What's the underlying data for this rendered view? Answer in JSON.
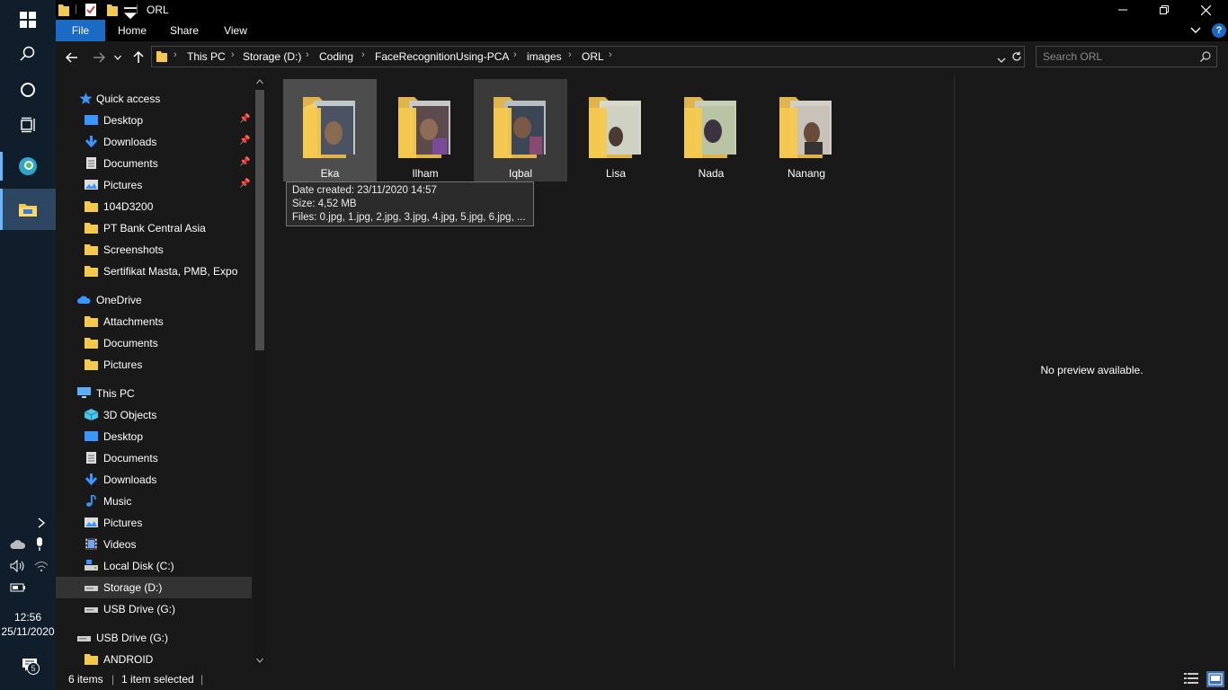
{
  "window": {
    "title": "ORL",
    "colors": {
      "file_tab": "#1b6ac4",
      "background": "#191919",
      "taskbar": "#101e2b"
    }
  },
  "ribbon": {
    "tabs": [
      "File",
      "Home",
      "Share",
      "View"
    ]
  },
  "address": {
    "crumbs": [
      "This PC",
      "Storage (D:)",
      "Coding",
      "FaceRecognitionUsing-PCA",
      "images",
      "ORL"
    ]
  },
  "search": {
    "placeholder": "Search ORL"
  },
  "nav": {
    "quick_access": {
      "label": "Quick access",
      "items": [
        {
          "label": "Desktop",
          "icon": "desktop-icon",
          "pinned": true
        },
        {
          "label": "Downloads",
          "icon": "downloads-icon",
          "pinned": true
        },
        {
          "label": "Documents",
          "icon": "documents-icon",
          "pinned": true
        },
        {
          "label": "Pictures",
          "icon": "pictures-icon",
          "pinned": true
        },
        {
          "label": "104D3200",
          "icon": "folder-icon"
        },
        {
          "label": "PT Bank Central Asia",
          "icon": "folder-icon"
        },
        {
          "label": "Screenshots",
          "icon": "folder-icon"
        },
        {
          "label": "Sertifikat Masta, PMB, Expo",
          "icon": "folder-icon"
        }
      ]
    },
    "onedrive": {
      "label": "OneDrive",
      "items": [
        {
          "label": "Attachments",
          "icon": "folder-icon"
        },
        {
          "label": "Documents",
          "icon": "folder-icon"
        },
        {
          "label": "Pictures",
          "icon": "folder-icon"
        }
      ]
    },
    "this_pc": {
      "label": "This PC",
      "items": [
        {
          "label": "3D Objects",
          "icon": "3d-objects-icon"
        },
        {
          "label": "Desktop",
          "icon": "desktop-icon"
        },
        {
          "label": "Documents",
          "icon": "documents-icon"
        },
        {
          "label": "Downloads",
          "icon": "downloads-icon"
        },
        {
          "label": "Music",
          "icon": "music-icon"
        },
        {
          "label": "Pictures",
          "icon": "pictures-icon"
        },
        {
          "label": "Videos",
          "icon": "videos-icon"
        },
        {
          "label": "Local Disk (C:)",
          "icon": "drive-icon"
        },
        {
          "label": "Storage (D:)",
          "icon": "drive-icon",
          "selected": true
        },
        {
          "label": "USB Drive (G:)",
          "icon": "drive-icon"
        }
      ]
    },
    "usb": {
      "label": "USB Drive (G:)",
      "items": [
        {
          "label": "ANDROID",
          "icon": "folder-icon"
        }
      ]
    }
  },
  "folders": [
    {
      "name": "Eka",
      "state": "selected"
    },
    {
      "name": "Ilham",
      "state": "normal"
    },
    {
      "name": "Iqbal",
      "state": "hover"
    },
    {
      "name": "Lisa",
      "state": "normal"
    },
    {
      "name": "Nada",
      "state": "normal"
    },
    {
      "name": "Nanang",
      "state": "normal"
    }
  ],
  "tooltip": {
    "date": "Date created: 23/11/2020 14:57",
    "size": "Size: 4,52 MB",
    "files": "Files: 0.jpg, 1.jpg, 2.jpg, 3.jpg, 4.jpg, 5.jpg, 6.jpg, ..."
  },
  "preview": {
    "text": "No preview available."
  },
  "status": {
    "items": "6 items",
    "selected": "1 item selected"
  },
  "clock": {
    "time": "12:56",
    "date": "25/11/2020"
  },
  "notifications": {
    "count": "5"
  }
}
